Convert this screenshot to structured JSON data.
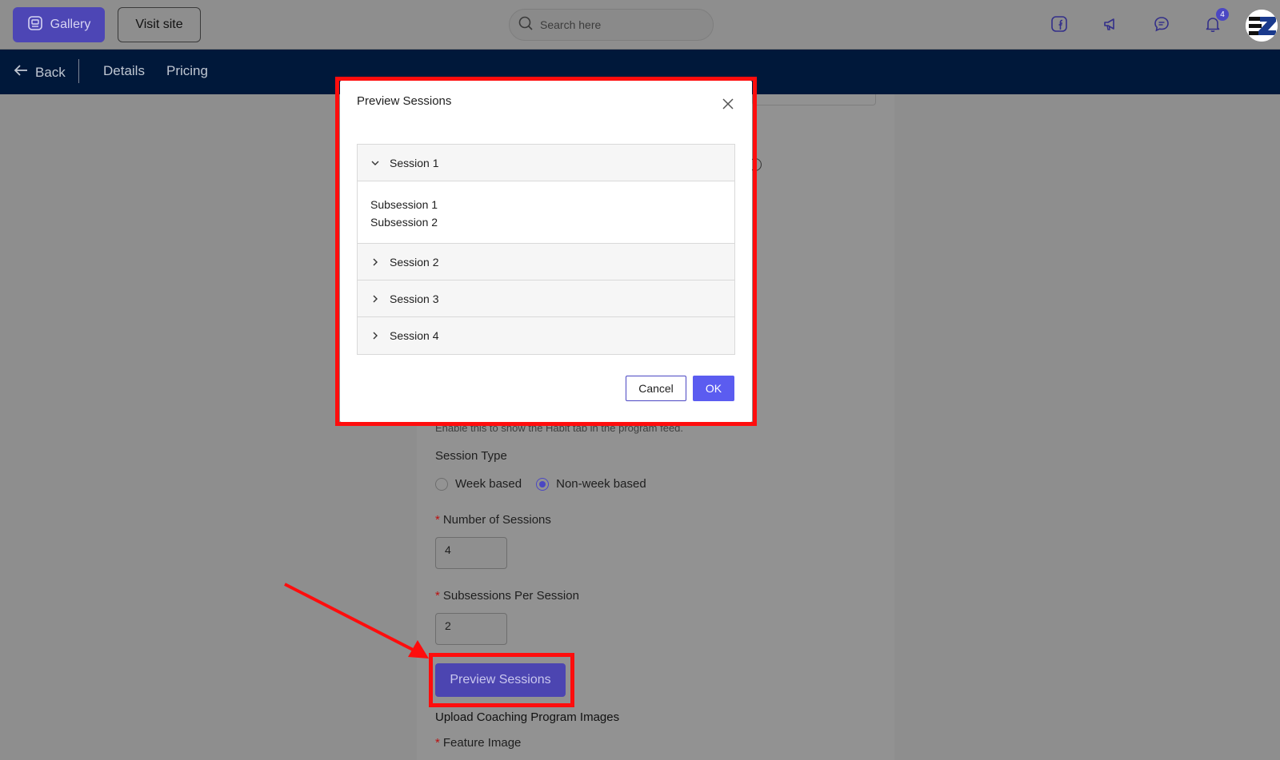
{
  "topbar": {
    "gallery_label": "Gallery",
    "visit_site_label": "Visit site",
    "search_placeholder": "Search here",
    "notification_count": "4"
  },
  "navbar": {
    "back_label": "Back",
    "tabs": [
      "Details",
      "Pricing"
    ]
  },
  "page": {
    "habit_help_text": "Enable this to show the Habit tab in the program feed.",
    "session_type_label": "Session Type",
    "session_type_options": [
      "Week based",
      "Non-week based"
    ],
    "session_type_selected": "Non-week based",
    "num_sessions_label": "Number of Sessions",
    "num_sessions_value": "4",
    "subsessions_label": "Subsessions Per Session",
    "subsessions_value": "2",
    "preview_button_label": "Preview Sessions",
    "upload_heading": "Upload Coaching Program Images",
    "feature_image_label": "Feature Image",
    "required_marker": "*"
  },
  "modal": {
    "title": "Preview Sessions",
    "sessions": [
      {
        "label": "Session 1",
        "expanded": true,
        "subsessions": [
          "Subsession 1",
          "Subsession 2"
        ]
      },
      {
        "label": "Session 2",
        "expanded": false
      },
      {
        "label": "Session 3",
        "expanded": false
      },
      {
        "label": "Session 4",
        "expanded": false
      }
    ],
    "cancel_label": "Cancel",
    "ok_label": "OK"
  },
  "colors": {
    "accent": "#4b47c3",
    "navbar_bg": "#00183a",
    "annotation_red": "#ff0d0d",
    "ok_button": "#5b5cf0"
  }
}
